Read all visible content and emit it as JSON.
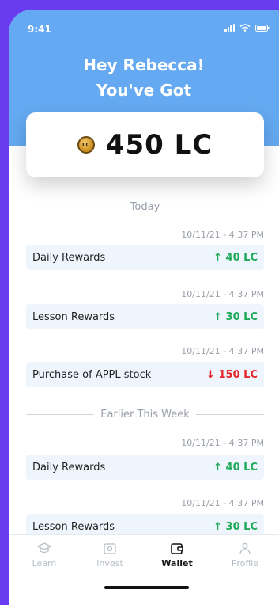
{
  "status_bar": {
    "time": "9:41"
  },
  "header": {
    "greeting_line1": "Hey Rebecca!",
    "greeting_line2": "You've Got"
  },
  "balance": {
    "coin_label": "LC",
    "value": "450 LC"
  },
  "sections": [
    {
      "title": "Today",
      "items": [
        {
          "time": "10/11/21 - 4:37 PM",
          "label": "Daily Rewards",
          "amount": "↑ 40 LC",
          "direction": "up"
        },
        {
          "time": "10/11/21 - 4:37 PM",
          "label": "Lesson Rewards",
          "amount": "↑ 30 LC",
          "direction": "up"
        },
        {
          "time": "10/11/21 - 4:37 PM",
          "label": "Purchase of APPL stock",
          "amount": "↓ 150 LC",
          "direction": "down"
        }
      ]
    },
    {
      "title": "Earlier This Week",
      "items": [
        {
          "time": "10/11/21 - 4:37 PM",
          "label": "Daily Rewards",
          "amount": "↑ 40 LC",
          "direction": "up"
        },
        {
          "time": "10/11/21 - 4:37 PM",
          "label": "Lesson Rewards",
          "amount": "↑ 30 LC",
          "direction": "up"
        }
      ]
    }
  ],
  "tabs": [
    {
      "label": "Learn",
      "icon": "graduation-cap-icon",
      "active": false
    },
    {
      "label": "Invest",
      "icon": "wallet-box-icon",
      "active": false
    },
    {
      "label": "Wallet",
      "icon": "wallet-icon",
      "active": true
    },
    {
      "label": "Profile",
      "icon": "user-icon",
      "active": false
    }
  ],
  "colors": {
    "outer_background": "#6a3cf0",
    "header_blue": "#64a9f1",
    "row_background": "#eef5fd",
    "positive": "#1faa59",
    "negative": "#e5252a"
  }
}
